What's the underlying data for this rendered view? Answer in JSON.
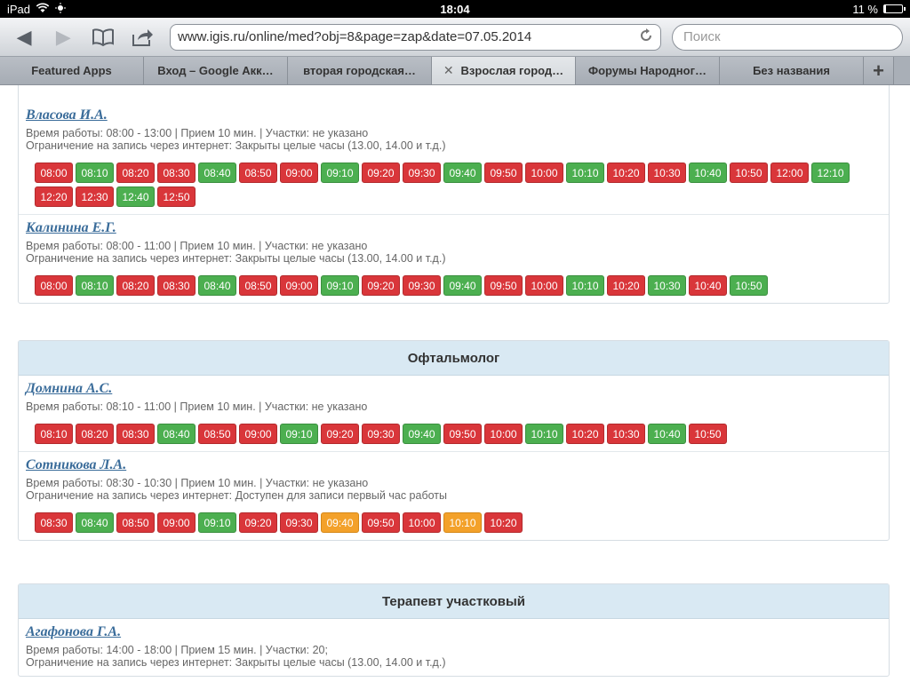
{
  "status": {
    "device": "iPad",
    "time": "18:04",
    "battery": "11 %",
    "battery_level": 0.11
  },
  "toolbar": {
    "back_icon": "back-arrow-icon",
    "forward_icon": "forward-arrow-icon",
    "bookmarks_icon": "book-icon",
    "share_icon": "share-icon",
    "url": "www.igis.ru/online/med?obj=8&page=zap&date=07.05.2014",
    "search_placeholder": "Поиск"
  },
  "tabs": [
    {
      "label": "Featured Apps",
      "active": false
    },
    {
      "label": "Вход – Google Акк…",
      "active": false
    },
    {
      "label": "вторая городская…",
      "active": false
    },
    {
      "label": "Взрослая город…",
      "active": true
    },
    {
      "label": "Форумы Народног…",
      "active": false
    },
    {
      "label": "Без названия",
      "active": false
    }
  ],
  "sections": [
    {
      "title": "",
      "doctors": [
        {
          "name": "Власова И.А.",
          "info": "Время работы: 08:00 - 13:00 | Прием 10 мин. | Участки: не указано",
          "restriction": "Ограничение на запись через интернет: Закрыты целые часы (13.00, 14.00 и т.д.)",
          "slots": [
            {
              "t": "08:00",
              "s": "busy"
            },
            {
              "t": "08:10",
              "s": "free"
            },
            {
              "t": "08:20",
              "s": "busy"
            },
            {
              "t": "08:30",
              "s": "busy"
            },
            {
              "t": "08:40",
              "s": "free"
            },
            {
              "t": "08:50",
              "s": "busy"
            },
            {
              "t": "09:00",
              "s": "busy"
            },
            {
              "t": "09:10",
              "s": "free"
            },
            {
              "t": "09:20",
              "s": "busy"
            },
            {
              "t": "09:30",
              "s": "busy"
            },
            {
              "t": "09:40",
              "s": "free"
            },
            {
              "t": "09:50",
              "s": "busy"
            },
            {
              "t": "10:00",
              "s": "busy"
            },
            {
              "t": "10:10",
              "s": "free"
            },
            {
              "t": "10:20",
              "s": "busy"
            },
            {
              "t": "10:30",
              "s": "busy"
            },
            {
              "t": "10:40",
              "s": "free"
            },
            {
              "t": "10:50",
              "s": "busy"
            },
            {
              "t": "12:00",
              "s": "busy"
            },
            {
              "t": "12:10",
              "s": "free"
            },
            {
              "t": "12:20",
              "s": "busy"
            },
            {
              "t": "12:30",
              "s": "busy"
            },
            {
              "t": "12:40",
              "s": "free"
            },
            {
              "t": "12:50",
              "s": "busy"
            }
          ]
        },
        {
          "name": "Калинина Е.Г.",
          "info": "Время работы: 08:00 - 11:00 | Прием 10 мин. | Участки: не указано",
          "restriction": "Ограничение на запись через интернет: Закрыты целые часы (13.00, 14.00 и т.д.)",
          "slots": [
            {
              "t": "08:00",
              "s": "busy"
            },
            {
              "t": "08:10",
              "s": "free"
            },
            {
              "t": "08:20",
              "s": "busy"
            },
            {
              "t": "08:30",
              "s": "busy"
            },
            {
              "t": "08:40",
              "s": "free"
            },
            {
              "t": "08:50",
              "s": "busy"
            },
            {
              "t": "09:00",
              "s": "busy"
            },
            {
              "t": "09:10",
              "s": "free"
            },
            {
              "t": "09:20",
              "s": "busy"
            },
            {
              "t": "09:30",
              "s": "busy"
            },
            {
              "t": "09:40",
              "s": "free"
            },
            {
              "t": "09:50",
              "s": "busy"
            },
            {
              "t": "10:00",
              "s": "busy"
            },
            {
              "t": "10:10",
              "s": "free"
            },
            {
              "t": "10:20",
              "s": "busy"
            },
            {
              "t": "10:30",
              "s": "free"
            },
            {
              "t": "10:40",
              "s": "busy"
            },
            {
              "t": "10:50",
              "s": "free"
            }
          ]
        }
      ]
    },
    {
      "title": "Офтальмолог",
      "doctors": [
        {
          "name": "Домнина А.С.",
          "info": "Время работы: 08:10 - 11:00 | Прием 10 мин. | Участки: не указано",
          "restriction": "",
          "slots": [
            {
              "t": "08:10",
              "s": "busy"
            },
            {
              "t": "08:20",
              "s": "busy"
            },
            {
              "t": "08:30",
              "s": "busy"
            },
            {
              "t": "08:40",
              "s": "free"
            },
            {
              "t": "08:50",
              "s": "busy"
            },
            {
              "t": "09:00",
              "s": "busy"
            },
            {
              "t": "09:10",
              "s": "free"
            },
            {
              "t": "09:20",
              "s": "busy"
            },
            {
              "t": "09:30",
              "s": "busy"
            },
            {
              "t": "09:40",
              "s": "free"
            },
            {
              "t": "09:50",
              "s": "busy"
            },
            {
              "t": "10:00",
              "s": "busy"
            },
            {
              "t": "10:10",
              "s": "free"
            },
            {
              "t": "10:20",
              "s": "busy"
            },
            {
              "t": "10:30",
              "s": "busy"
            },
            {
              "t": "10:40",
              "s": "free"
            },
            {
              "t": "10:50",
              "s": "busy"
            }
          ]
        },
        {
          "name": "Сотникова Л.А.",
          "info": "Время работы: 08:30 - 10:30 | Прием 10 мин. | Участки: не указано",
          "restriction": "Ограничение на запись через интернет: Доступен для записи первый час работы",
          "slots": [
            {
              "t": "08:30",
              "s": "busy"
            },
            {
              "t": "08:40",
              "s": "free"
            },
            {
              "t": "08:50",
              "s": "busy"
            },
            {
              "t": "09:00",
              "s": "busy"
            },
            {
              "t": "09:10",
              "s": "free"
            },
            {
              "t": "09:20",
              "s": "busy"
            },
            {
              "t": "09:30",
              "s": "busy"
            },
            {
              "t": "09:40",
              "s": "limit"
            },
            {
              "t": "09:50",
              "s": "busy"
            },
            {
              "t": "10:00",
              "s": "busy"
            },
            {
              "t": "10:10",
              "s": "limit"
            },
            {
              "t": "10:20",
              "s": "busy"
            }
          ]
        }
      ]
    },
    {
      "title": "Терапевт участковый",
      "doctors": [
        {
          "name": "Агафонова Г.А.",
          "info": "Время работы: 14:00 - 18:00 | Прием 15 мин. | Участки: 20;",
          "restriction": "Ограничение на запись через интернет: Закрыты целые часы (13.00, 14.00 и т.д.)",
          "slots": []
        }
      ]
    }
  ],
  "colors": {
    "busy": "#d9363a",
    "free": "#4caf50",
    "limit": "#f3a12a",
    "header_bg": "#d9e9f3",
    "doctor_link": "#3a6c9a"
  }
}
